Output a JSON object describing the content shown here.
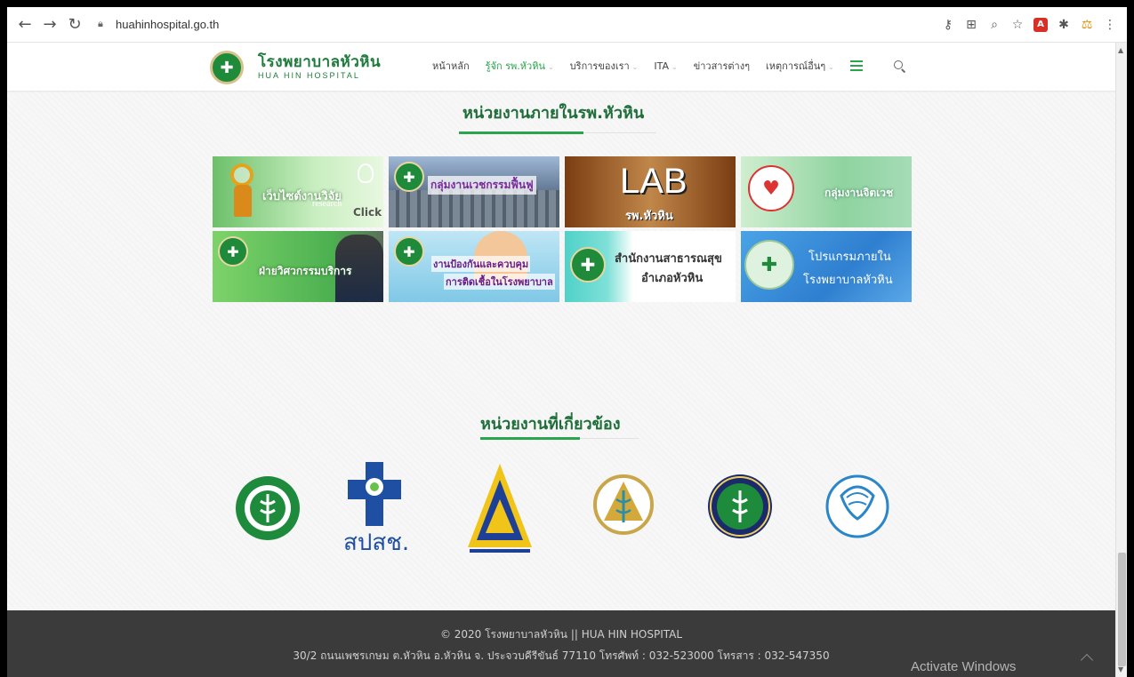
{
  "browser": {
    "url": "huahinhospital.go.th",
    "back_icon": "back-arrow-icon",
    "forward_icon": "forward-arrow-icon",
    "reload_icon": "reload-icon"
  },
  "header": {
    "logo_th": "โรงพยาบาลหัวหิน",
    "logo_en": "HUA HIN HOSPITAL",
    "menu": [
      {
        "label": "หน้าหลัก"
      },
      {
        "label": "รู้จัก รพ.หัวหิน"
      },
      {
        "label": "บริการของเรา"
      },
      {
        "label": "ITA"
      },
      {
        "label": "ข่าวสารต่างๆ"
      },
      {
        "label": "เหตุการณ์อื่นๆ"
      }
    ]
  },
  "sections": {
    "internal_title": "หน่วยงานภายในรพ.หัวหิน",
    "related_title": "หน่วยงานที่เกี่ยวข้อง"
  },
  "tiles": [
    {
      "label": "เว็บไซต์งานวิจัย",
      "sub1": "research",
      "sub2": "Click"
    },
    {
      "label": "กลุ่มงานเวชกรรมฟื้นฟู"
    },
    {
      "label": "LAB",
      "sub1": "รพ.หัวหิน"
    },
    {
      "label": "กลุ่มงานจิตเวช"
    },
    {
      "label": "ฝ่ายวิศวกรรมบริการ"
    },
    {
      "label": "งานป้องกันและควบคุม",
      "sub1": "การติดเชื้อในโรงพยาบาล"
    },
    {
      "label": "สำนักงานสาธารณสุข",
      "sub1": "อำเภอหัวหิน"
    },
    {
      "label": "โปรแกรมภายใน",
      "sub1": "โรงพยาบาลหัวหิน"
    }
  ],
  "agencies": [
    {
      "icon": "ministry-of-public-health-seal-icon"
    },
    {
      "icon": "nhso-logo-icon",
      "text": "สปสช."
    },
    {
      "icon": "social-security-office-logo-icon"
    },
    {
      "icon": "prachuap-hospital-logo-icon"
    },
    {
      "icon": "provincial-health-office-seal-icon"
    },
    {
      "icon": "comptroller-general-department-logo-icon"
    }
  ],
  "footer": {
    "line1": "© 2020 โรงพยาบาลหัวหิน || HUA HIN HOSPITAL",
    "line2": "30/2 ถนนเพชรเกษม ต.หัวหิน อ.หัวหิน จ. ประจวบคีรีขันธ์ 77110 โทรศัพท์ : 032-523000 โทรสาร : 032-547350"
  },
  "watermark": "Activate Windows",
  "colors": {
    "brand_green": "#1e7b3c",
    "accent_green": "#2aa44d",
    "footer_bg": "#3b3b3b"
  }
}
